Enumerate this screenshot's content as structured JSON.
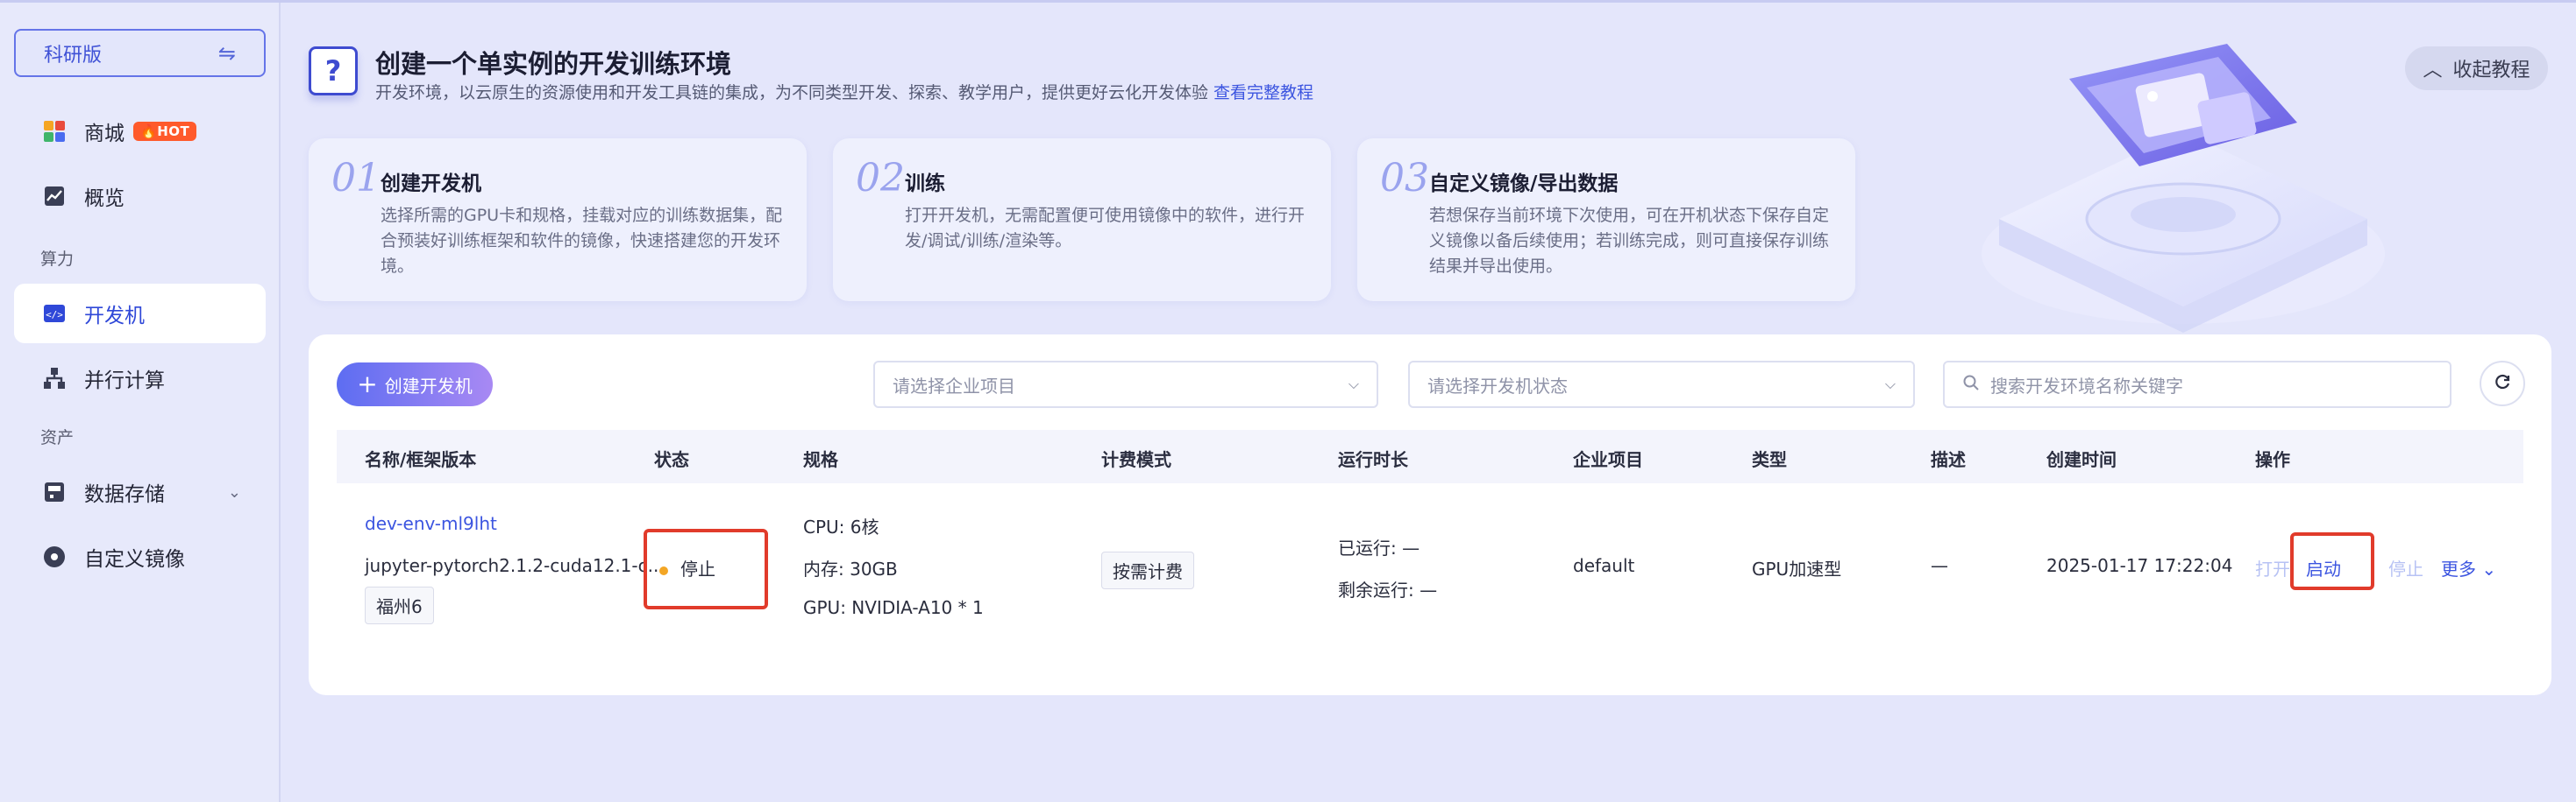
{
  "sidebar": {
    "edition": "科研版",
    "items": [
      {
        "label": "商城",
        "badge": "HOT"
      },
      {
        "label": "概览"
      },
      {
        "label": "开发机"
      },
      {
        "label": "并行计算"
      },
      {
        "label": "数据存储"
      },
      {
        "label": "自定义镜像"
      }
    ],
    "sections": [
      "算力",
      "资产"
    ]
  },
  "header": {
    "title": "创建一个单实例的开发训练环境",
    "subtitle": "开发环境，以云原生的资源使用和开发工具链的集成，为不同类型开发、探索、教学用户，提供更好云化开发体验",
    "tutorial_link": "查看完整教程",
    "collapse": "收起教程"
  },
  "steps": [
    {
      "num": "01",
      "title": "创建开发机",
      "desc": "选择所需的GPU卡和规格，挂载对应的训练数据集，配合预装好训练框架和软件的镜像，快速搭建您的开发环境。"
    },
    {
      "num": "02",
      "title": "训练",
      "desc": "打开开发机，无需配置便可使用镜像中的软件，进行开发/调试/训练/渲染等。"
    },
    {
      "num": "03",
      "title": "自定义镜像/导出数据",
      "desc": "若想保存当前环境下次使用，可在开机状态下保存自定义镜像以备后续使用；若训练完成，则可直接保存训练结果并导出使用。"
    }
  ],
  "toolbar": {
    "create": "创建开发机",
    "project_placeholder": "请选择企业项目",
    "status_placeholder": "请选择开发机状态",
    "search_placeholder": "搜索开发环境名称关键字"
  },
  "table": {
    "columns": [
      "名称/框架版本",
      "状态",
      "规格",
      "计费模式",
      "运行时长",
      "企业项目",
      "类型",
      "描述",
      "创建时间",
      "操作"
    ],
    "rows": [
      {
        "name": "dev-env-ml9lht",
        "image": "jupyter-pytorch2.1.2-cuda12.1-c...",
        "region": "福州6",
        "status": "停止",
        "cpu": "CPU: 6核",
        "mem": "内存: 30GB",
        "gpu": "GPU: NVIDIA-A10 * 1",
        "billing": "按需计费",
        "ran": "已运行: —",
        "remain": "剩余运行: —",
        "project": "default",
        "type": "GPU加速型",
        "desc": "—",
        "created": "2025-01-17 17:22:04",
        "actions": {
          "open": "打开",
          "start": "启动",
          "stop": "停止",
          "more": "更多"
        }
      }
    ]
  }
}
